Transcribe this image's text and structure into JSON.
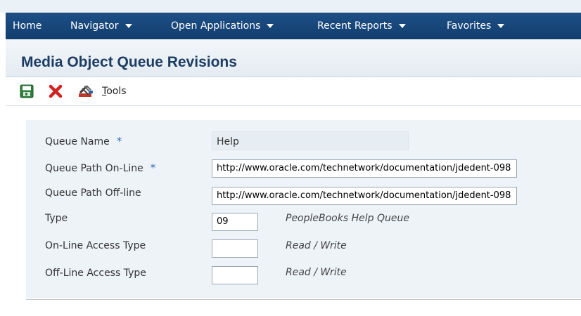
{
  "nav": {
    "home": "Home",
    "navigator": "Navigator",
    "open_applications": "Open Applications",
    "recent_reports": "Recent Reports",
    "favorites": "Favorites"
  },
  "page": {
    "title": "Media Object Queue Revisions"
  },
  "toolbar": {
    "tools_underlined": "T",
    "tools_rest": "ools"
  },
  "form": {
    "queue_name": {
      "label": "Queue Name",
      "required": "*",
      "value": "Help"
    },
    "path_online": {
      "label": "Queue Path On-Line",
      "required": "*",
      "value": "http://www.oracle.com/technetwork/documentation/jdedent-098"
    },
    "path_offline": {
      "label": "Queue Path Off-line",
      "value": "http://www.oracle.com/technetwork/documentation/jdedent-098"
    },
    "type": {
      "label": "Type",
      "value": "09",
      "description": "PeopleBooks Help Queue"
    },
    "online_access": {
      "label": "On-Line Access Type",
      "value": "",
      "description": "Read / Write"
    },
    "offline_access": {
      "label": "Off-Line Access Type",
      "value": "",
      "description": "Read / Write"
    }
  },
  "colors": {
    "nav_bg": "#1d4f86",
    "title_text": "#1c3d63",
    "required_star": "#2e6ab5",
    "form_bg": "#eef3f8"
  },
  "icons": [
    "save-icon",
    "cancel-icon",
    "tools-icon"
  ]
}
